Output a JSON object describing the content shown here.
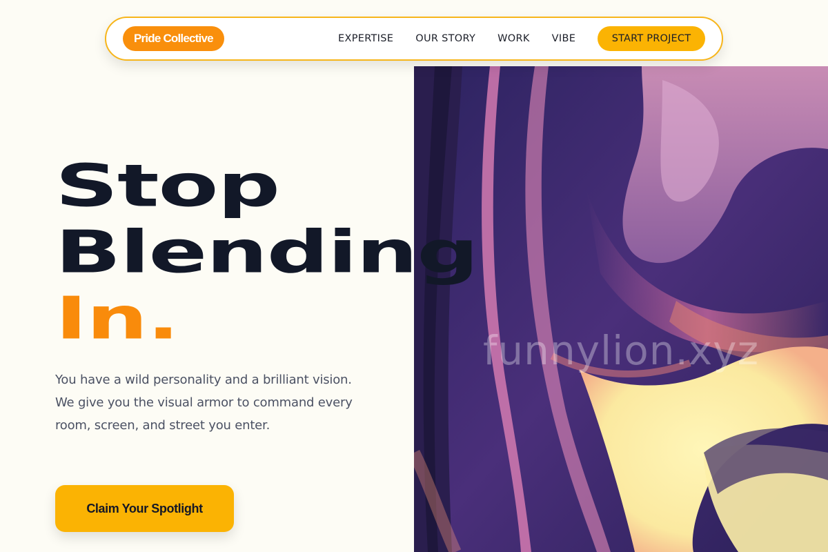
{
  "nav": {
    "brand": "Pride Collective",
    "links": [
      "EXPERTISE",
      "OUR STORY",
      "WORK",
      "VIBE"
    ],
    "cta": "START PROJECT"
  },
  "hero": {
    "headline_line1": "Stop",
    "headline_line2": "Blending",
    "headline_line3": "In.",
    "subtext": "You have a wild personality and a brilliant vision. We give you the visual armor to command every room, screen, and street you enter.",
    "cta": "Claim Your Spotlight",
    "image_watermark": "funnylion.xyz"
  },
  "colors": {
    "background": "#fdfcf5",
    "accent_orange": "#f98f0c",
    "accent_yellow": "#fbb303",
    "headline_dark": "#121828",
    "body_text": "#4b5163"
  }
}
